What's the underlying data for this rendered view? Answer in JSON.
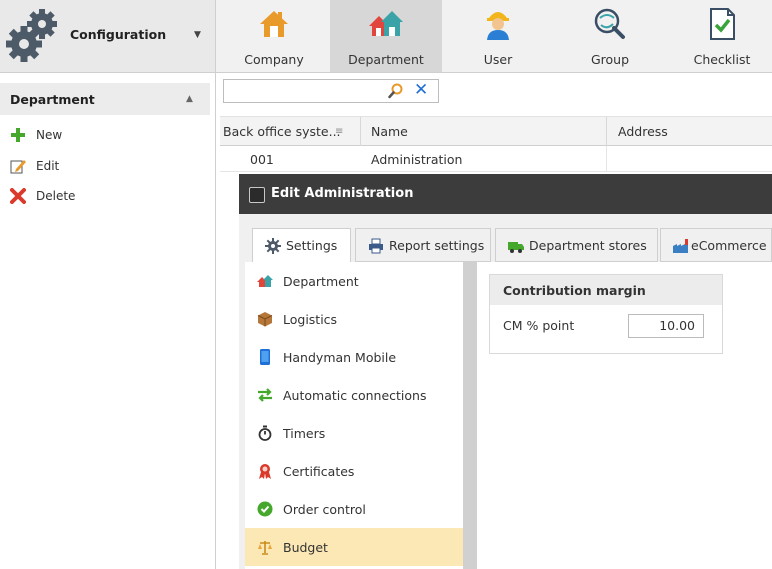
{
  "config": {
    "title": "Configuration",
    "icon": "gears-icon"
  },
  "nav": {
    "items": [
      {
        "label": "Company",
        "icon": "house-icon",
        "active": false
      },
      {
        "label": "Department",
        "icon": "houses-icon",
        "active": true
      },
      {
        "label": "User",
        "icon": "worker-icon",
        "active": false
      },
      {
        "label": "Group",
        "icon": "globe-icon",
        "active": false
      },
      {
        "label": "Checklist",
        "icon": "checklist-icon",
        "active": false
      }
    ]
  },
  "leftpanel": {
    "title": "Department",
    "actions": [
      {
        "label": "New",
        "icon": "plus-icon"
      },
      {
        "label": "Edit",
        "icon": "edit-icon"
      },
      {
        "label": "Delete",
        "icon": "delete-icon"
      }
    ]
  },
  "search": {
    "value": "",
    "placeholder": ""
  },
  "grid": {
    "columns": [
      "Back office syste...",
      "Name",
      "Address"
    ],
    "rows": [
      {
        "code": "001",
        "name": "Administration",
        "address": ""
      }
    ]
  },
  "dialog": {
    "title": "Edit Administration",
    "tabs": [
      {
        "label": "Settings",
        "icon": "gear-icon",
        "active": true
      },
      {
        "label": "Report settings",
        "icon": "printer-icon",
        "active": false
      },
      {
        "label": "Department stores",
        "icon": "truck-icon",
        "active": false
      },
      {
        "label": "eCommerce",
        "icon": "factory-icon",
        "active": false
      }
    ],
    "sidelist": [
      {
        "label": "Department",
        "icon": "houses-icon",
        "selected": false
      },
      {
        "label": "Logistics",
        "icon": "box-icon",
        "selected": false
      },
      {
        "label": "Handyman Mobile",
        "icon": "phone-icon",
        "selected": false
      },
      {
        "label": "Automatic connections",
        "icon": "arrows-icon",
        "selected": false
      },
      {
        "label": "Timers",
        "icon": "stopwatch-icon",
        "selected": false
      },
      {
        "label": "Certificates",
        "icon": "ribbon-icon",
        "selected": false
      },
      {
        "label": "Order control",
        "icon": "check-circle-icon",
        "selected": false
      },
      {
        "label": "Budget",
        "icon": "scales-icon",
        "selected": true
      }
    ],
    "contribution": {
      "title": "Contribution margin",
      "field_label": "CM % point",
      "field_value": "10.00"
    }
  }
}
